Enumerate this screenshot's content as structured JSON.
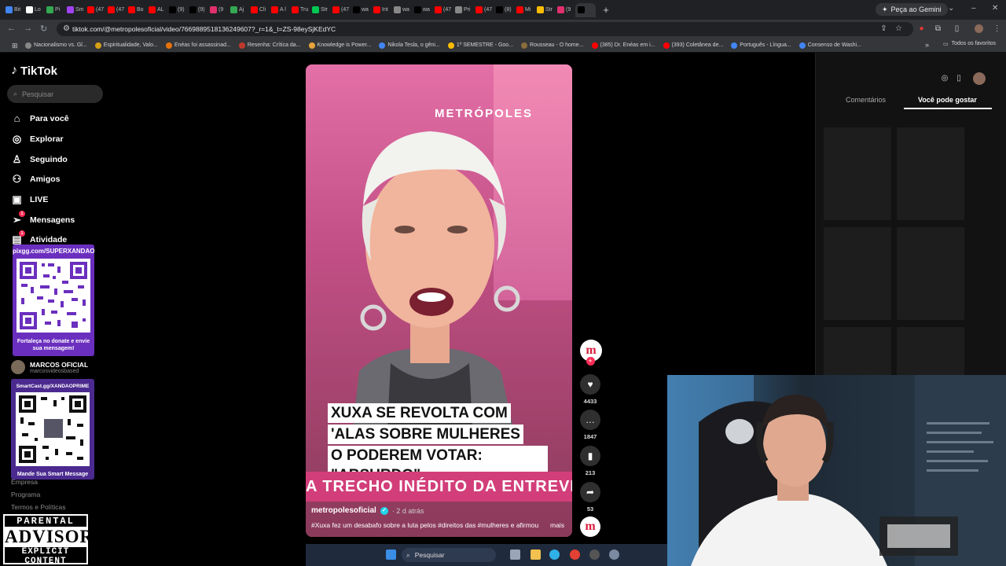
{
  "browser": {
    "tabs": [
      {
        "label": "Bit",
        "color": "#4285f4"
      },
      {
        "label": "Lo",
        "color": "#ffffff"
      },
      {
        "label": "Pi",
        "color": "#34a853"
      },
      {
        "label": "Sm",
        "color": "#a142f4"
      },
      {
        "label": "(47",
        "color": "#ff0000"
      },
      {
        "label": "(47",
        "color": "#ff0000"
      },
      {
        "label": "Bo",
        "color": "#ff0000"
      },
      {
        "label": "AL",
        "color": "#ff0000"
      },
      {
        "label": "(9)",
        "color": "#000000"
      },
      {
        "label": "(9)",
        "color": "#000000"
      },
      {
        "label": "(9",
        "color": "#e1306c"
      },
      {
        "label": "Aj",
        "color": "#34a853"
      },
      {
        "label": "Cli",
        "color": "#ff0000"
      },
      {
        "label": "A l",
        "color": "#ff0000"
      },
      {
        "label": "Tru",
        "color": "#ff0000"
      },
      {
        "label": "Str",
        "color": "#00c853"
      },
      {
        "label": "(47",
        "color": "#ff0000"
      },
      {
        "label": "wa",
        "color": "#000000"
      },
      {
        "label": "Int",
        "color": "#ff0000"
      },
      {
        "label": "wa",
        "color": "#888888"
      },
      {
        "label": "wa",
        "color": "#000000"
      },
      {
        "label": "(47",
        "color": "#ff0000"
      },
      {
        "label": "Pri",
        "color": "#888888"
      },
      {
        "label": "(47",
        "color": "#ff0000"
      },
      {
        "label": "(8)",
        "color": "#000000"
      },
      {
        "label": "Mi",
        "color": "#ff0000"
      },
      {
        "label": "Str",
        "color": "#fbbc04"
      },
      {
        "label": "(9",
        "color": "#e1306c"
      },
      {
        "label": "",
        "color": "#000000"
      }
    ],
    "gemini_label": "Peça ao Gemini",
    "url": "tiktok.com/@metropolesoficial/video/7669889518136249607?_r=1&_t=ZS-98eySjKEdYC",
    "bookmarks": [
      {
        "label": "Nacionalismo vs. Gl...",
        "color": "#888888"
      },
      {
        "label": "Espiritualidade, Valo...",
        "color": "#d4a017"
      },
      {
        "label": "Enéas foi assassinad...",
        "color": "#e8710a"
      },
      {
        "label": "Resenha: Crítica da...",
        "color": "#c0392b"
      },
      {
        "label": "Knowledge is Power...",
        "color": "#e8a33b"
      },
      {
        "label": "Nikola Tesla, o gêni...",
        "color": "#4285f4"
      },
      {
        "label": "1º SEMESTRE - Goo...",
        "color": "#fbbc04"
      },
      {
        "label": "Rousseau - O home...",
        "color": "#8a6d3b"
      },
      {
        "label": "(385) Dr. Enéas em i...",
        "color": "#ff0000"
      },
      {
        "label": "(393) Coletânea de...",
        "color": "#ff0000"
      },
      {
        "label": "Português - Língua...",
        "color": "#4285f4"
      },
      {
        "label": "Consenso de Washi...",
        "color": "#4285f4"
      }
    ],
    "all_bookmarks": "Todos os favoritos"
  },
  "sidebar": {
    "brand": "TikTok",
    "search_placeholder": "Pesquisar",
    "items": [
      {
        "label": "Para você",
        "icon": "home-icon"
      },
      {
        "label": "Explorar",
        "icon": "compass-icon"
      },
      {
        "label": "Seguindo",
        "icon": "following-icon"
      },
      {
        "label": "Amigos",
        "icon": "friends-icon"
      },
      {
        "label": "LIVE",
        "icon": "live-icon"
      },
      {
        "label": "Mensagens",
        "icon": "messages-icon"
      },
      {
        "label": "Atividade",
        "icon": "activity-icon"
      }
    ],
    "messages_badge": "1",
    "activity_badge": "1",
    "account_name": "MARCOS OFICIAL",
    "account_handle": "marcosvideosbased",
    "footer": [
      "Empresa",
      "Programa",
      "Termos e Políticas"
    ]
  },
  "overlays": {
    "qr1_url": "pixgg.com/SUPERXANDAO",
    "qr1_text": "Fortaleça no donate e envie sua mensagem!",
    "qr2_url": "SmartCast.gg/XANDAOPRIME",
    "qr2_text": "Mande Sua Smart Message",
    "advisory_l1": "PARENTAL",
    "advisory_l2": "ADVISORY",
    "advisory_l3": "EXPLICIT CONTENT"
  },
  "video": {
    "brand": "METRÓPOLES",
    "headline_lines": [
      "XUXA SE REVOLTA COM",
      "'ALAS SOBRE MULHERES",
      "O PODEREM VOTAR: \"ABSURDO\""
    ],
    "ticker": "A TRECHO INÉDITO DA ENTREVIST",
    "author": "metropolesoficial",
    "time": "· 2 d atrás",
    "description": "#Xuxa fez um desabafo sobre a luta pelos #direitos das #mulheres e afirmou",
    "more": "mais"
  },
  "actions": {
    "likes": "4433",
    "comments": "1847",
    "saves": "213",
    "shares": "53"
  },
  "right_panel": {
    "tab_comments": "Comentários",
    "tab_suggested": "Você pode gostar"
  },
  "taskbar": {
    "search_placeholder": "Pesquisar"
  }
}
